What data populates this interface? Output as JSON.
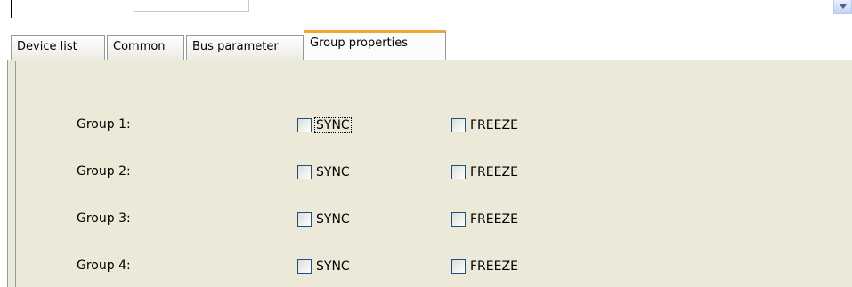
{
  "tabs": [
    {
      "label": "Device list",
      "active": false
    },
    {
      "label": "Common",
      "active": false
    },
    {
      "label": "Bus parameter",
      "active": false
    },
    {
      "label": "Group properties",
      "active": true
    }
  ],
  "groups": [
    {
      "label": "Group 1:",
      "sync_label": "SYNC",
      "sync_checked": false,
      "freeze_label": "FREEZE",
      "freeze_checked": false,
      "focused": true
    },
    {
      "label": "Group 2:",
      "sync_label": "SYNC",
      "sync_checked": false,
      "freeze_label": "FREEZE",
      "freeze_checked": false
    },
    {
      "label": "Group 3:",
      "sync_label": "SYNC",
      "sync_checked": false,
      "freeze_label": "FREEZE",
      "freeze_checked": false
    },
    {
      "label": "Group 4:",
      "sync_label": "SYNC",
      "sync_checked": false,
      "freeze_label": "FREEZE",
      "freeze_checked": false
    }
  ],
  "icons": {
    "scroll_arrow": "chevron-down-icon"
  },
  "colors": {
    "panel_bg": "#ece9d8",
    "active_tab_accent": "#f0a43a",
    "checkbox_border": "#1c5180"
  }
}
